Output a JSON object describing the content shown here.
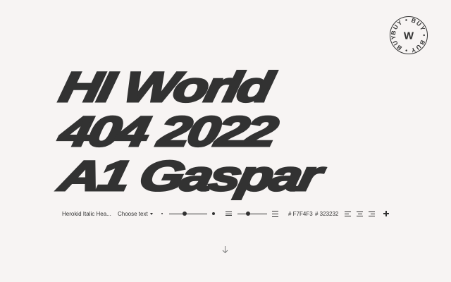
{
  "buy_badge": {
    "ring_text": "BUY • BUY • BUY • BUY •",
    "letter": "W"
  },
  "specimen": {
    "lines": [
      "HI World",
      "404 2022",
      "A1 Gaspar"
    ]
  },
  "toolbar": {
    "font_name": "Herokid Italic Hea...",
    "text_selector_label": "Choose text",
    "size_slider_value": 0.4,
    "line_height_slider_value": 0.35,
    "background_color": "# F7F4F3",
    "text_color": "# 323232"
  },
  "colors": {
    "background": "#F7F4F3",
    "text": "#323232"
  },
  "icons": {
    "scroll": "arrow-down-icon",
    "add": "plus-icon"
  }
}
